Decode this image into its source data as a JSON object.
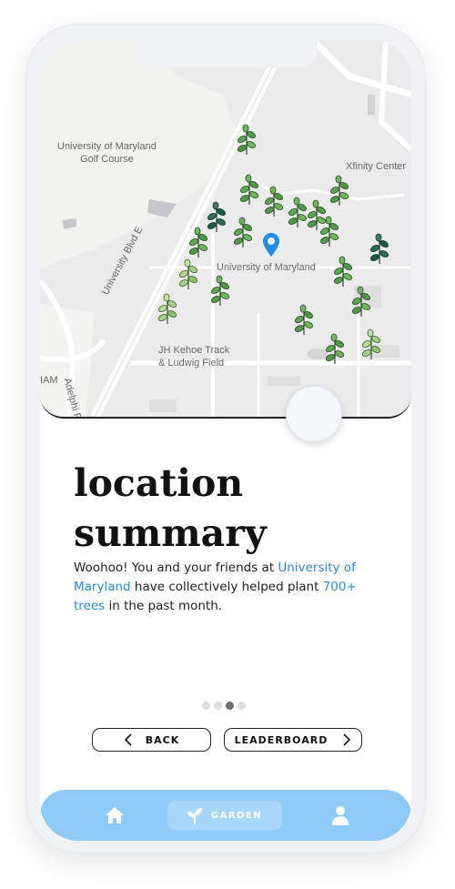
{
  "map": {
    "labels": {
      "golf_course": "University of Maryland\nGolf Course",
      "xfinity": "Xfinity Center",
      "campus": "University of Maryland",
      "track": "JH Kehoe Track\n& Ludwig Field",
      "blvd": "University Blvd E",
      "adelphi": "Adelphi Rd",
      "iam": "IAM"
    },
    "pin_icon": "location-pin-icon",
    "tree_icon": "tree-icon"
  },
  "content": {
    "title_line1": "location",
    "title_line2": "summary",
    "desc_part1": "Woohoo! You and your friends at ",
    "desc_highlight1": "University of Maryland",
    "desc_part2": " have collectively helped plant ",
    "desc_highlight2": "700+ trees",
    "desc_part3": " in the past month."
  },
  "pagination": {
    "total": 4,
    "active_index": 2
  },
  "buttons": {
    "back_label": "BACK",
    "leaderboard_label": "LEADERBOARD"
  },
  "tabbar": {
    "home_icon": "home-icon",
    "garden_label": "GARDEN",
    "garden_icon": "sprout-icon",
    "profile_icon": "user-icon"
  },
  "colors": {
    "accent": "#2a8ad4",
    "tabbar": "#8ccbf7",
    "tree_dark": "#1f5a45",
    "tree_mid": "#5aa84e",
    "tree_light": "#a6d486"
  }
}
